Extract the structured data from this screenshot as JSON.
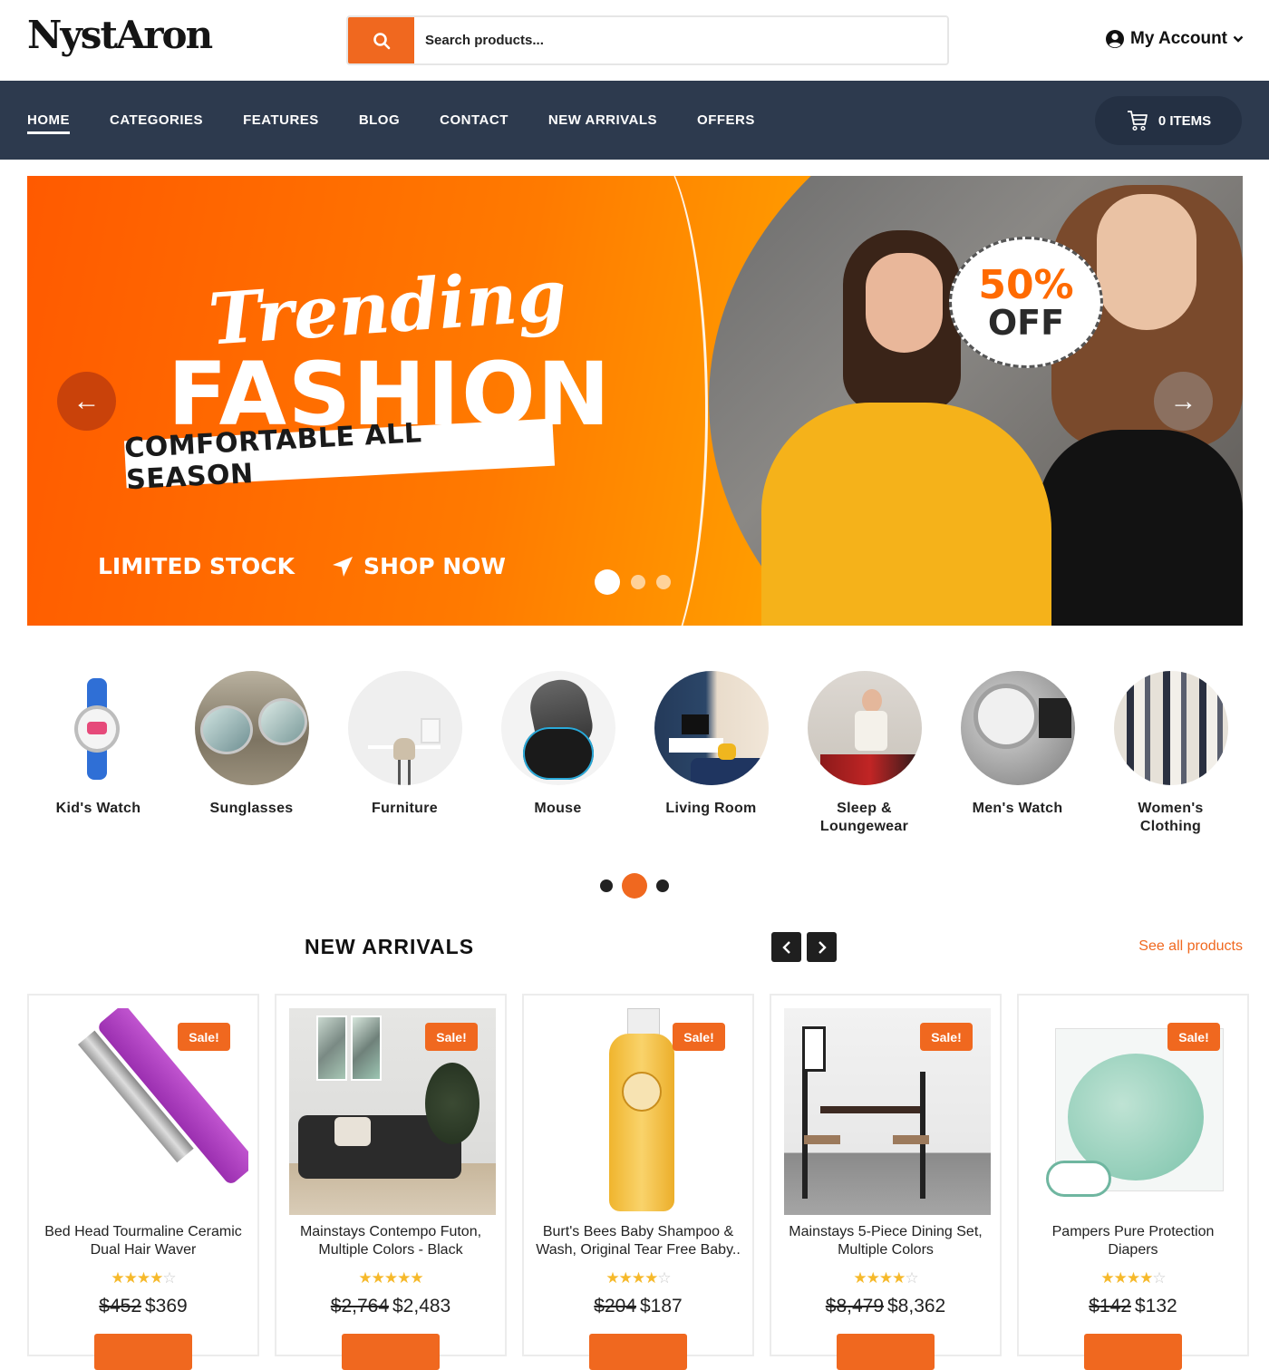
{
  "brand": {
    "name": "NystAron",
    "accent": "#f0681f",
    "nav_bg": "#2d3a4e"
  },
  "search": {
    "placeholder": "Search products...",
    "icon": "search-icon"
  },
  "account": {
    "label": "My Account",
    "icon": "user-circle-icon"
  },
  "nav": {
    "items": [
      {
        "label": "HOME",
        "active": true
      },
      {
        "label": "CATEGORIES"
      },
      {
        "label": "FEATURES"
      },
      {
        "label": "BLOG"
      },
      {
        "label": "CONTACT"
      },
      {
        "label": "NEW ARRIVALS"
      },
      {
        "label": "OFFERS"
      }
    ],
    "cart_label": "0 ITEMS"
  },
  "hero": {
    "script_title": "Trending",
    "title": "FASHION",
    "band": "COMFORTABLE ALL SEASON",
    "limited": "LIMITED STOCK",
    "shop_now": "SHOP NOW",
    "badge_pct": "50%",
    "badge_off": "OFF",
    "prev_arrow": "←",
    "next_arrow": "→",
    "slides": 3,
    "active_slide": 1
  },
  "categories": {
    "items": [
      {
        "label": "Kid's Watch"
      },
      {
        "label": "Sunglasses"
      },
      {
        "label": "Furniture"
      },
      {
        "label": "Mouse"
      },
      {
        "label": "Living Room"
      },
      {
        "label": "Sleep & Loungewear"
      },
      {
        "label": "Men's Watch"
      },
      {
        "label": "Women's Clothing"
      }
    ],
    "pages": 3,
    "active_page": 2
  },
  "new_arrivals": {
    "title": "NEW ARRIVALS",
    "see_all": "See all products",
    "products": [
      {
        "name": "Bed Head Tourmaline Ceramic Dual Hair Waver",
        "badge": "Sale!",
        "rating": 4,
        "old_price": "$452",
        "price": "$369"
      },
      {
        "name": "Mainstays Contempo Futon, Multiple Colors - Black",
        "badge": "Sale!",
        "rating": 5,
        "old_price": "$2,764",
        "price": "$2,483"
      },
      {
        "name": "Burt's Bees Baby Shampoo & Wash, Original Tear Free Baby..",
        "badge": "Sale!",
        "rating": 4,
        "old_price": "$204",
        "price": "$187"
      },
      {
        "name": "Mainstays 5-Piece Dining Set, Multiple Colors",
        "badge": "Sale!",
        "rating": 4,
        "old_price": "$8,479",
        "price": "$8,362"
      },
      {
        "name": "Pampers Pure Protection Diapers",
        "badge": "Sale!",
        "rating": 4,
        "old_price": "$142",
        "price": "$132"
      }
    ]
  }
}
